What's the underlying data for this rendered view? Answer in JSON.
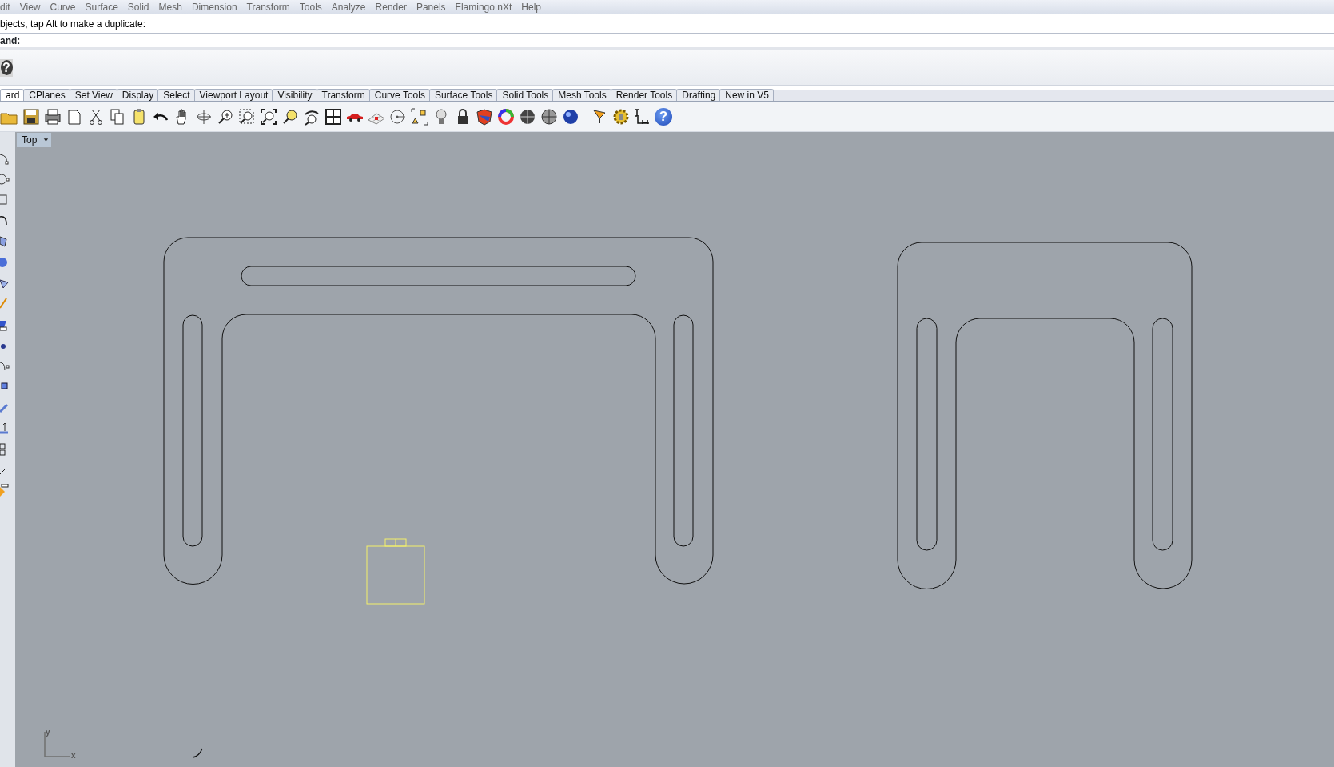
{
  "menu": [
    "dit",
    "View",
    "Curve",
    "Surface",
    "Solid",
    "Mesh",
    "Dimension",
    "Transform",
    "Tools",
    "Analyze",
    "Render",
    "Panels",
    "Flamingo nXt",
    "Help"
  ],
  "command_history": "bjects, tap Alt to make a duplicate:",
  "command_prompt": "and:",
  "help_glyph": "?",
  "tabs": [
    {
      "label": "ard",
      "selected": true
    },
    {
      "label": "CPlanes",
      "selected": false
    },
    {
      "label": "Set View",
      "selected": false
    },
    {
      "label": "Display",
      "selected": false
    },
    {
      "label": "Select",
      "selected": false
    },
    {
      "label": "Viewport Layout",
      "selected": false
    },
    {
      "label": "Visibility",
      "selected": false
    },
    {
      "label": "Transform",
      "selected": false
    },
    {
      "label": "Curve Tools",
      "selected": false
    },
    {
      "label": "Surface Tools",
      "selected": false
    },
    {
      "label": "Solid Tools",
      "selected": false
    },
    {
      "label": "Mesh Tools",
      "selected": false
    },
    {
      "label": "Render Tools",
      "selected": false
    },
    {
      "label": "Drafting",
      "selected": false
    },
    {
      "label": "New in V5",
      "selected": false
    }
  ],
  "toolbar_help_glyph": "?",
  "viewport": {
    "title": "Top",
    "axis_y": "y",
    "axis_x": "x"
  }
}
